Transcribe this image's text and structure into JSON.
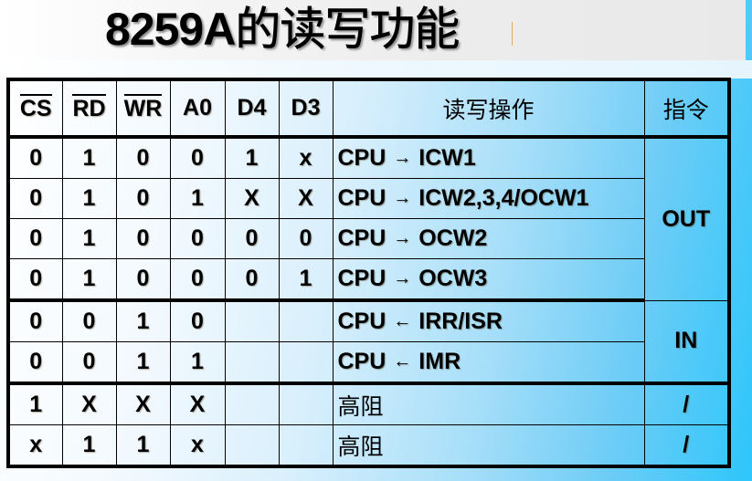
{
  "title": {
    "prefix": "8259A",
    "suffix": "的读写功能"
  },
  "table": {
    "headers": {
      "cs": "CS",
      "rd": "RD",
      "wr": "WR",
      "a0": "A0",
      "d4": "D4",
      "d3": "D3",
      "operation": "读写操作",
      "instruction": "指令"
    },
    "overlined_headers": [
      "CS",
      "RD",
      "WR"
    ],
    "rows": [
      {
        "cs": "0",
        "rd": "1",
        "wr": "0",
        "a0": "0",
        "d4": "1",
        "d3": "x",
        "src": "CPU",
        "arrow": "→",
        "dst": "ICW1"
      },
      {
        "cs": "0",
        "rd": "1",
        "wr": "0",
        "a0": "1",
        "d4": "X",
        "d3": "X",
        "src": "CPU",
        "arrow": "→",
        "dst": "ICW2,3,4/OCW1"
      },
      {
        "cs": "0",
        "rd": "1",
        "wr": "0",
        "a0": "0",
        "d4": "0",
        "d3": "0",
        "src": "CPU",
        "arrow": "→",
        "dst": "OCW2"
      },
      {
        "cs": "0",
        "rd": "1",
        "wr": "0",
        "a0": "0",
        "d4": "0",
        "d3": "1",
        "src": "CPU",
        "arrow": "→",
        "dst": "OCW3"
      },
      {
        "cs": "0",
        "rd": "0",
        "wr": "1",
        "a0": "0",
        "d4": "",
        "d3": "",
        "src": "CPU",
        "arrow": "←",
        "dst": "IRR/ISR"
      },
      {
        "cs": "0",
        "rd": "0",
        "wr": "1",
        "a0": "1",
        "d4": "",
        "d3": "",
        "src": "CPU",
        "arrow": "←",
        "dst": "IMR"
      },
      {
        "cs": "1",
        "rd": "X",
        "wr": "X",
        "a0": "X",
        "d4": "",
        "d3": "",
        "text": "高阻"
      },
      {
        "cs": "x",
        "rd": "1",
        "wr": "1",
        "a0": "x",
        "d4": "",
        "d3": "",
        "text": "高阻"
      }
    ],
    "instructions": {
      "out": "OUT",
      "in": "IN",
      "none_1": "/",
      "none_2": "/"
    }
  }
}
